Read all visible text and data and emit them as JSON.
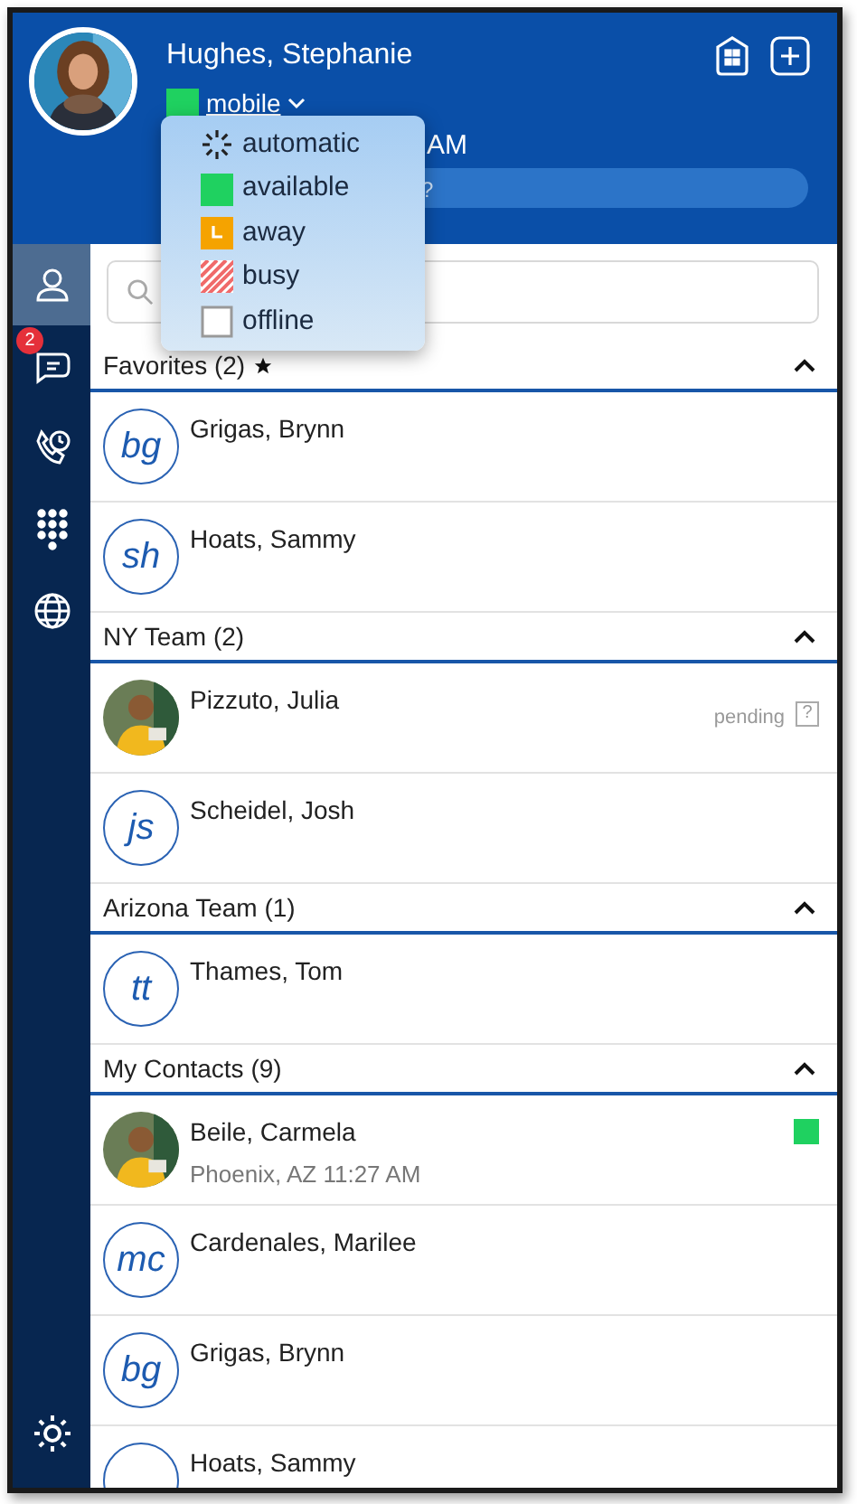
{
  "header": {
    "name": "Hughes, Stephanie",
    "status": {
      "kind": "available"
    },
    "device": "mobile",
    "time_fragment": "AM",
    "bar_fragment": "?"
  },
  "status_menu": [
    {
      "kind": "automatic",
      "label": "automatic"
    },
    {
      "kind": "available",
      "label": "available"
    },
    {
      "kind": "away",
      "label": "away"
    },
    {
      "kind": "busy",
      "label": "busy"
    },
    {
      "kind": "offline",
      "label": "offline"
    }
  ],
  "sidebar": {
    "items": [
      {
        "kind": "contacts",
        "selected": true
      },
      {
        "kind": "chat",
        "selected": false,
        "badge": "2"
      },
      {
        "kind": "calls",
        "selected": false
      },
      {
        "kind": "dialpad",
        "selected": false
      },
      {
        "kind": "web",
        "selected": false
      }
    ]
  },
  "groups": [
    {
      "title": "Favorites (2)",
      "starred": true,
      "expanded": true,
      "contacts": [
        {
          "name": "Grigas, Brynn",
          "kind": "initials",
          "initials": "bg"
        },
        {
          "name": "Hoats, Sammy",
          "kind": "initials",
          "initials": "sh"
        }
      ]
    },
    {
      "title": "NY Team (2)",
      "starred": false,
      "expanded": true,
      "contacts": [
        {
          "name": "Pizzuto, Julia",
          "status": "pending",
          "status_mark": "?"
        },
        {
          "name": "Scheidel, Josh",
          "kind": "initials",
          "initials": "js"
        }
      ]
    },
    {
      "title": "Arizona Team (1)",
      "starred": false,
      "expanded": true,
      "contacts": [
        {
          "name": "Thames, Tom",
          "kind": "initials",
          "initials": "tt"
        }
      ]
    },
    {
      "title": "My Contacts (9)",
      "starred": false,
      "expanded": true,
      "contacts": [
        {
          "name": "Beile, Carmela",
          "detail": "Phoenix, AZ 11:27 AM",
          "presence": {
            "kind": "available"
          }
        },
        {
          "name": "Cardenales, Marilee",
          "kind": "initials",
          "initials": "mc"
        },
        {
          "name": "Grigas, Brynn",
          "kind": "initials",
          "initials": "bg"
        },
        {
          "name": "Hoats, Sammy",
          "kind": "initials"
        }
      ]
    }
  ]
}
